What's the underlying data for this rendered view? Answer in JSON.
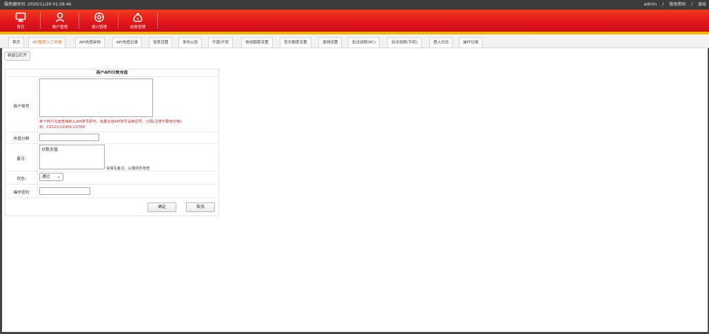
{
  "topbar": {
    "time_label": "服务器时间: 2020/11/29 01:28:46",
    "user": "admin",
    "sep1": "/",
    "change_password": "修改密码",
    "sep2": "/",
    "logout": "退出"
  },
  "nav": {
    "items": [
      {
        "label": "首页",
        "icon": "monitor-icon"
      },
      {
        "label": "账户管理",
        "icon": "user-icon"
      },
      {
        "label": "报计管理",
        "icon": "gear-icon"
      },
      {
        "label": "结账管理",
        "icon": "money-bag-icon"
      }
    ]
  },
  "tabs": [
    {
      "label": "首页",
      "active": false
    },
    {
      "label": "API额度入工充值",
      "active": true
    },
    {
      "label": "API充值审核",
      "active": false
    },
    {
      "label": "API充值记录",
      "active": false
    },
    {
      "label": "倍率设置",
      "active": false
    },
    {
      "label": "发布公告",
      "active": false
    },
    {
      "label": "开盘/开奖",
      "active": false
    },
    {
      "label": "信用额度设置",
      "active": false
    },
    {
      "label": "官方额度设置",
      "active": false
    },
    {
      "label": "退佣设置",
      "active": false
    },
    {
      "label": "玩法说明(PC)",
      "active": false
    },
    {
      "label": "玩法说明(手机)",
      "active": false
    },
    {
      "label": "登入日志",
      "active": false
    },
    {
      "label": "操作记录",
      "active": false
    }
  ],
  "new_window_button": "新窗口打开",
  "form": {
    "title": "商户API分数充值",
    "account_label": "商户账号",
    "account_value": "",
    "account_hint_line1": "单个商户充值直接输入API账号即可，批量充值API账号请用逗号，分隔(注意不要有空格)",
    "account_hint_line2": "如：CZ123,CZ456,CZ789",
    "score_label": "充值分数",
    "score_value": "",
    "remark_label": "备注:",
    "remark_value": "分数充值",
    "remark_note": "请填写备注，以便财务核查",
    "status_label": "状态:",
    "status_value": "通过",
    "password_label": "操作密码",
    "password_value": "",
    "confirm_button": "确定",
    "cancel_button": "取消"
  },
  "colors": {
    "nav_red": "#e0141a",
    "gold_line": "#f0b400",
    "active_tab": "#e06a2a",
    "hint_red": "#d12b2b"
  }
}
